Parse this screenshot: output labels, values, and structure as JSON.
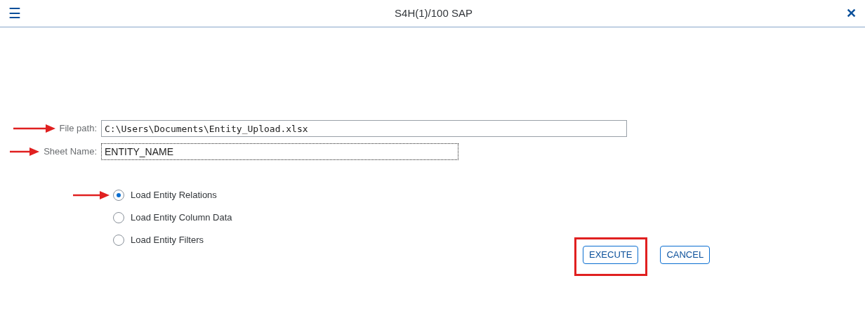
{
  "window": {
    "title": "S4H(1)/100 SAP",
    "menu_icon": "☰",
    "close_icon": "✕"
  },
  "fields": [
    {
      "label": "File path:",
      "value": "C:\\Users\\Documents\\Entity_Upload.xlsx",
      "kind": "mono",
      "focused": false,
      "annotated": true
    },
    {
      "label": "Sheet Name:",
      "value": "ENTITY_NAME",
      "kind": "plain",
      "focused": true,
      "annotated": true
    }
  ],
  "options": [
    {
      "label": "Load Entity Relations",
      "selected": true,
      "annotated": true
    },
    {
      "label": "Load Entity Column Data",
      "selected": false,
      "annotated": false
    },
    {
      "label": "Load Entity Filters",
      "selected": false,
      "annotated": false
    }
  ],
  "buttons": [
    {
      "label": "EXECUTE",
      "highlighted": true
    },
    {
      "label": "CANCEL",
      "highlighted": false
    }
  ]
}
